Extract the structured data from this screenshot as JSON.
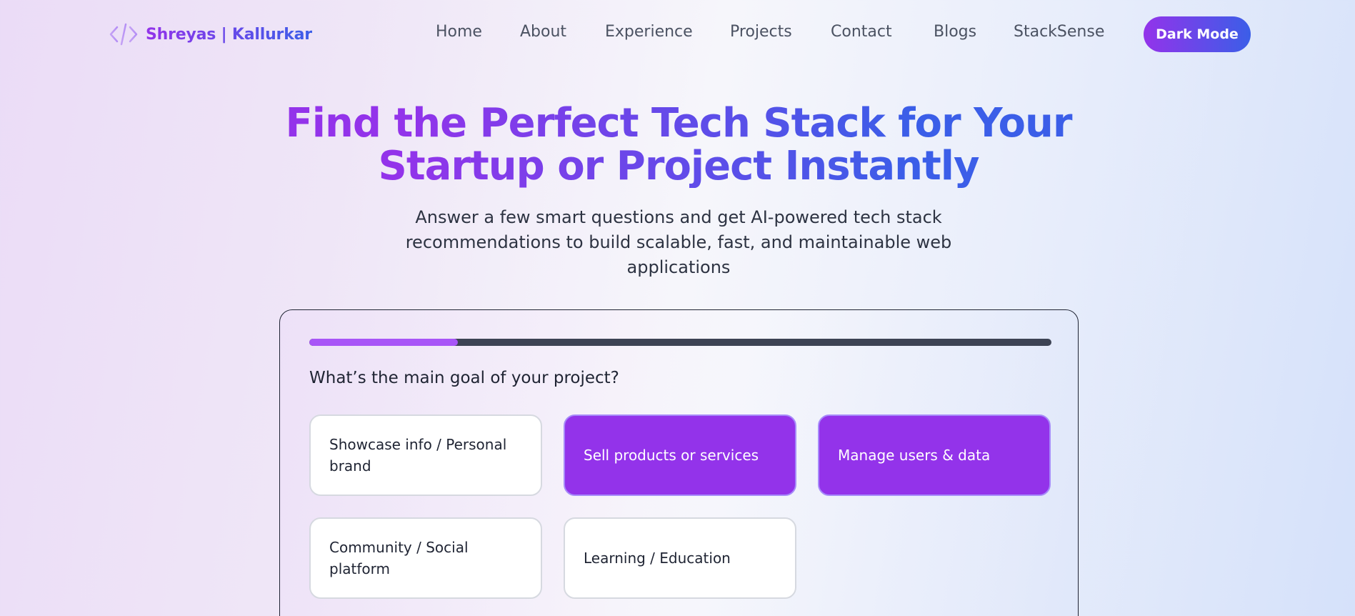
{
  "header": {
    "logo_text": "Shreyas | Kallurkar",
    "logo_icon": "code-brackets-icon",
    "nav": [
      "Home",
      "About",
      "Experience",
      "Projects",
      "Contact",
      "Blogs",
      "StackSense"
    ],
    "theme_toggle_label": "Dark Mode"
  },
  "hero": {
    "title": "Find the Perfect Tech Stack for Your Startup or Project Instantly",
    "subtitle": "Answer a few smart questions and get AI-powered tech stack recommendations to build scalable, fast, and maintainable web applications"
  },
  "quiz": {
    "progress_fraction": 0.2,
    "question": "What’s the main goal of your project?",
    "options": [
      {
        "label": "Showcase info / Personal brand",
        "selected": false
      },
      {
        "label": "Sell products or services",
        "selected": true
      },
      {
        "label": "Manage users & data",
        "selected": true
      },
      {
        "label": "Community / Social platform",
        "selected": false
      },
      {
        "label": "Learning / Education",
        "selected": false
      }
    ]
  },
  "colors": {
    "accent_purple": "#9333ea",
    "accent_blue": "#3b5ee8",
    "progress_fill": "#a855f7",
    "progress_track": "#3d4354"
  }
}
